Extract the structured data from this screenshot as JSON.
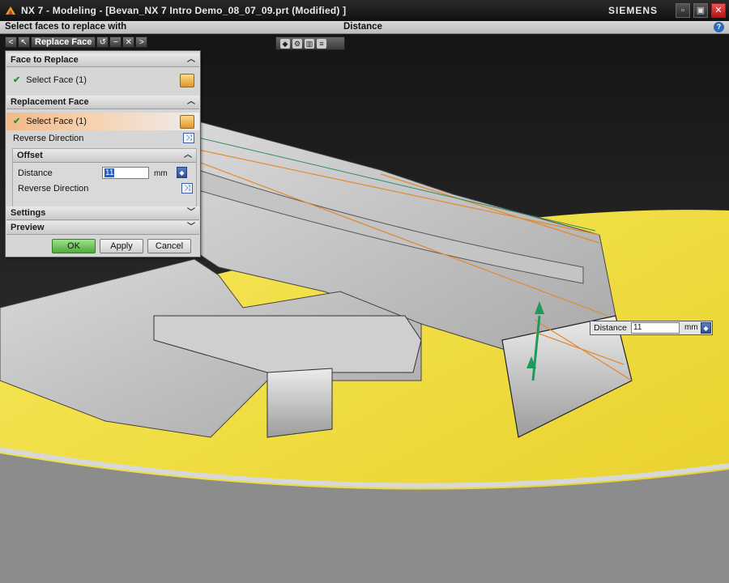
{
  "window": {
    "title": "NX 7 - Modeling - [Bevan_NX 7 Intro Demo_08_07_09.prt (Modified) ]",
    "brand": "SIEMENS",
    "min_glyph": "▫",
    "restore_glyph": "▣",
    "close_glyph": "✕"
  },
  "cue_line": {
    "prompt": "Select faces to replace with",
    "status": "Distance"
  },
  "dialog_tabs": {
    "name": "Replace Face"
  },
  "dialog": {
    "face_to_replace": {
      "header": "Face to Replace",
      "select_label": "Select Face (1)"
    },
    "replacement_face": {
      "header": "Replacement Face",
      "select_label": "Select Face (1)",
      "reverse_label": "Reverse Direction"
    },
    "offset": {
      "header": "Offset",
      "distance_label": "Distance",
      "distance_value": "11",
      "unit": "mm",
      "reverse_label": "Reverse Direction"
    },
    "settings_header": "Settings",
    "preview_header": "Preview",
    "buttons": {
      "ok": "OK",
      "apply": "Apply",
      "cancel": "Cancel"
    }
  },
  "onscreen_input": {
    "label": "Distance",
    "value": "11",
    "unit": "mm"
  },
  "colors": {
    "yellow_face": "#f2df3a",
    "highlight_orange": "#e08a2e",
    "arrow_green": "#1e9a5a",
    "part_gray": "#b8b8b8"
  }
}
